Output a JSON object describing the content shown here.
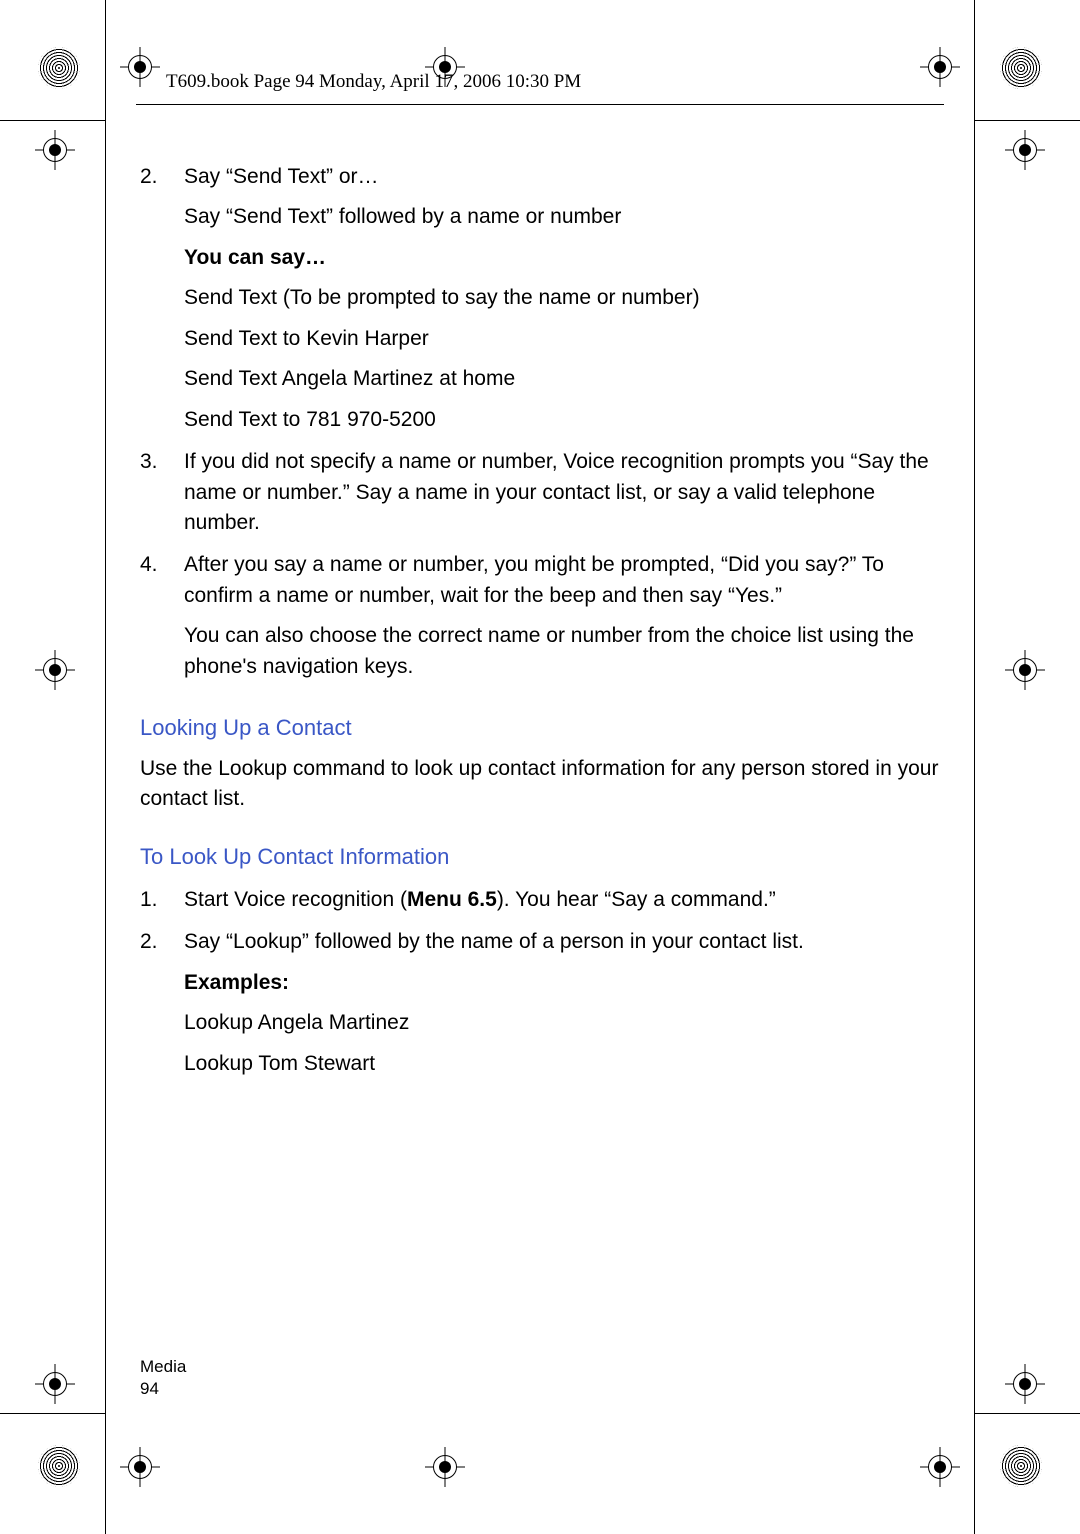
{
  "header": "T609.book  Page 94  Monday, April 17, 2006  10:30 PM",
  "items": [
    {
      "num": "2.",
      "text": "Say “Send Text” or…",
      "extra": [
        "Say “Send Text” followed by a name or number"
      ],
      "bold": "You can say…",
      "bullets": [
        "Send Text (To be prompted to say the name or number)",
        "Send Text to Kevin Harper",
        "Send Text Angela Martinez at home",
        "Send Text to 781 970-5200"
      ]
    },
    {
      "num": "3.",
      "text": "If you did not specify a name or number, Voice recognition prompts you “Say the name or number.” Say a name in your contact list, or say a valid telephone number."
    },
    {
      "num": "4.",
      "text": "After you say a name or number, you might be prompted, “Did you say?” To confirm a name or number, wait for the beep and then say “Yes.”",
      "extra": [
        "You can also choose the correct name or number from the choice list using the phone's navigation keys."
      ]
    }
  ],
  "sections": [
    {
      "title": "Looking Up a Contact",
      "body": "Use the Lookup command to look up contact information for any person stored in your contact list."
    }
  ],
  "lookup": {
    "title": "To Look Up Contact Information",
    "steps": [
      {
        "num": "1.",
        "pre": "Start Voice recognition (",
        "boldIn": "Menu 6.5",
        "post": "). You hear “Say a command.”"
      },
      {
        "num": "2.",
        "text": "Say “Lookup” followed by the name of a person in your contact list."
      }
    ],
    "examplesLabel": "Examples:",
    "examples": [
      "Lookup Angela Martinez",
      "Lookup Tom Stewart"
    ]
  },
  "footer": {
    "section": "Media",
    "page": "94"
  }
}
